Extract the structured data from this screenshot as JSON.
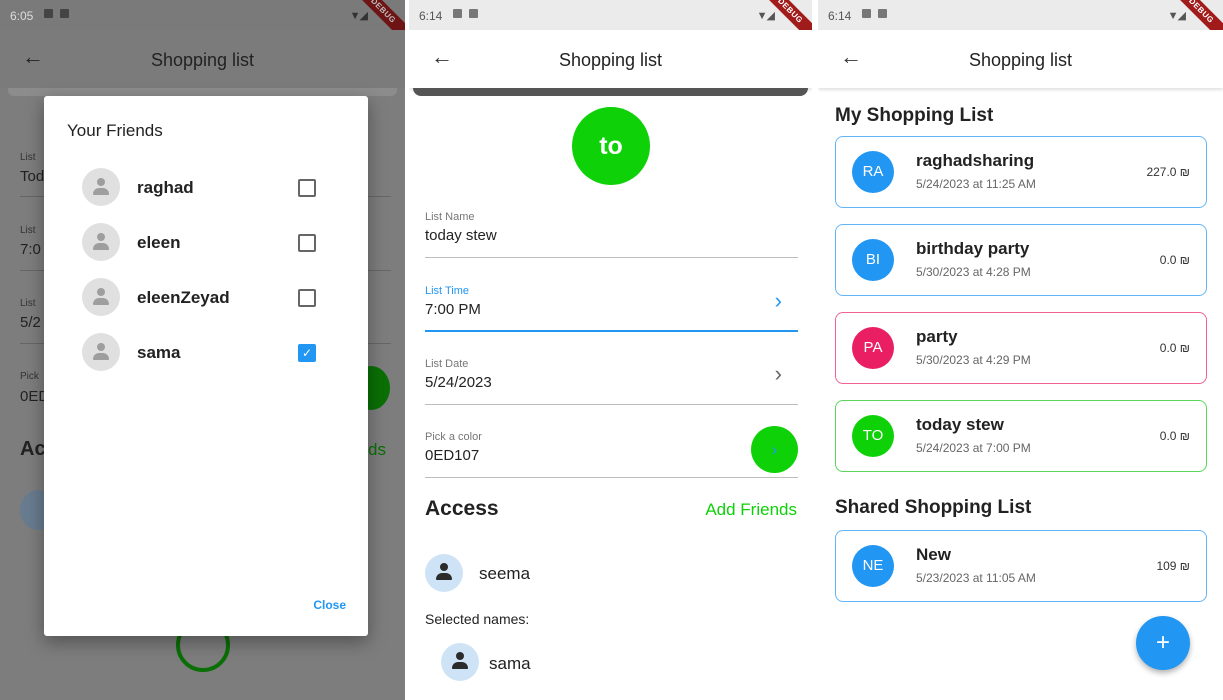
{
  "screen1": {
    "status_time": "6:05",
    "appbar_title": "Shopping list",
    "debug_label": "DEBUG",
    "bg_label_list": "List",
    "bg_value_list": "Tod",
    "bg_label_time": "List",
    "bg_value_time": "7:0",
    "bg_label_date": "List",
    "bg_value_date": "5/2",
    "bg_label_pick": "Pick",
    "bg_value_pick": "0ED",
    "bg_access": "Ac",
    "bg_friends": "ds",
    "dialog": {
      "title": "Your Friends",
      "friends": [
        {
          "name": "raghad",
          "checked": false
        },
        {
          "name": "eleen",
          "checked": false
        },
        {
          "name": "eleenZeyad",
          "checked": false
        },
        {
          "name": "sama",
          "checked": true
        }
      ],
      "close_label": "Close"
    }
  },
  "screen2": {
    "status_time": "6:14",
    "appbar_title": "Shopping list",
    "debug_label": "DEBUG",
    "avatar_text": "to",
    "list_name_label": "List Name",
    "list_name_value": "today stew",
    "list_time_label": "List Time",
    "list_time_value": "7:00 PM",
    "list_date_label": "List Date",
    "list_date_value": "5/24/2023",
    "color_label": "Pick a color",
    "color_value": "0ED107",
    "access_title": "Access",
    "add_friends_label": "Add Friends",
    "access_user": "seema",
    "selected_label": "Selected names:",
    "selected_user": "sama"
  },
  "screen3": {
    "status_time": "6:14",
    "appbar_title": "Shopping list",
    "debug_label": "DEBUG",
    "my_lists_title": "My Shopping List",
    "my_lists": [
      {
        "initials": "RA",
        "name": "raghadsharing",
        "time": "5/24/2023 at 11:25 AM",
        "price": "227.0 ₪",
        "color": "#2196f3",
        "border": "#64b5f6"
      },
      {
        "initials": "BI",
        "name": "birthday party",
        "time": "5/30/2023 at 4:28 PM",
        "price": "0.0 ₪",
        "color": "#2196f3",
        "border": "#64b5f6"
      },
      {
        "initials": "PA",
        "name": "party",
        "time": "5/30/2023 at 4:29 PM",
        "price": "0.0 ₪",
        "color": "#e91e63",
        "border": "#f06292"
      },
      {
        "initials": "TO",
        "name": "today stew",
        "time": "5/24/2023 at 7:00 PM",
        "price": "0.0 ₪",
        "color": "#0ed107",
        "border": "#5bd65a"
      }
    ],
    "shared_title": "Shared Shopping List",
    "shared_lists": [
      {
        "initials": "NE",
        "name": "New",
        "time": "5/23/2023 at 11:05 AM",
        "price": "109 ₪",
        "color": "#2196f3",
        "border": "#64b5f6"
      }
    ],
    "fab_label": "+"
  },
  "colors": {
    "primary": "#2196f3",
    "accent_green": "#0ed107",
    "pink": "#e91e63",
    "debug_red": "#a11b1b"
  }
}
